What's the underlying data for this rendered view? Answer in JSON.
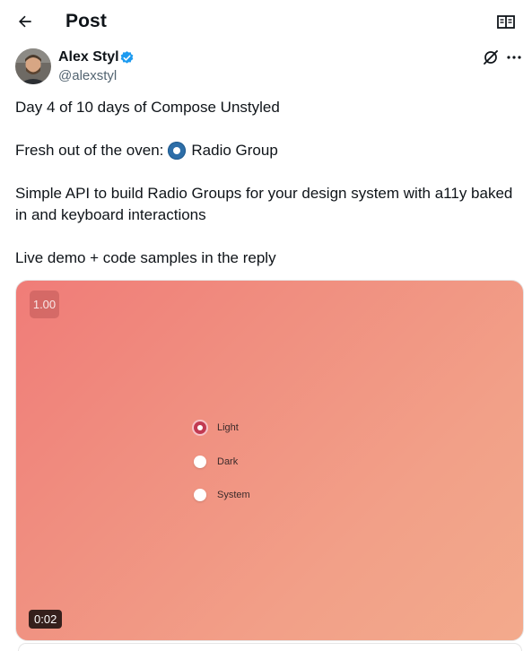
{
  "header": {
    "title": "Post",
    "back_icon": "arrow-left-icon",
    "reader_icon": "open-book-icon"
  },
  "author": {
    "name": "Alex Styl",
    "handle": "@alexstyl",
    "verified": true,
    "verified_color": "#1d9bf0"
  },
  "post": {
    "line1": "Day 4 of 10 days of Compose Unstyled",
    "line2_prefix": "Fresh out of the oven:",
    "line2_suffix": "Radio Group",
    "line3": "Simple API to build Radio Groups for your design system with a11y baked in and keyboard interactions",
    "line4": "Live demo + code samples in the reply"
  },
  "media": {
    "speed": "1.00",
    "duration": "0:02",
    "options": [
      {
        "label": "Light",
        "checked": true
      },
      {
        "label": "Dark",
        "checked": false
      },
      {
        "label": "System",
        "checked": false
      }
    ],
    "accent": "#c23a52"
  },
  "actions": {
    "grok_icon": "grok-icon",
    "more_icon": "more-horizontal-icon"
  }
}
